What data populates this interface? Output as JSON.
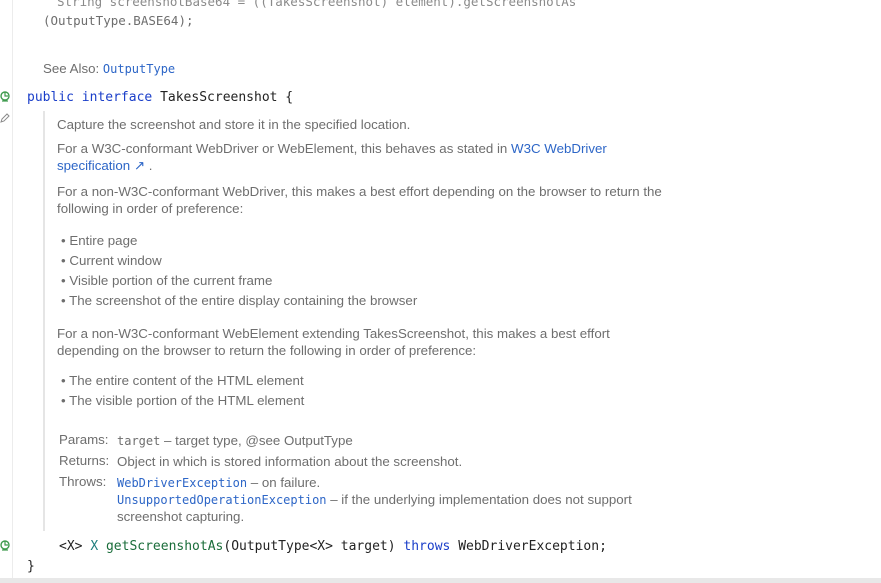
{
  "header_code": {
    "line1": "String screenshotBase64 = ((TakesScreenshot) element).getScreenshotAs",
    "line2": "(OutputType.BASE64);",
    "see_also_label": "See Also:",
    "see_also_link": "OutputType"
  },
  "declaration": {
    "public": "public",
    "interface": "interface",
    "name": "TakesScreenshot {"
  },
  "doc": {
    "p1": "Capture the screenshot and store it in the specified location.",
    "p2_pre": "For a W3C-conformant WebDriver or WebElement, this behaves as stated in ",
    "p2_link": "W3C WebDriver specification",
    "p2_post": " .",
    "p3": "For a non-W3C-conformant WebDriver, this makes a best effort depending on the browser to return the following in order of preference:",
    "list1": [
      "Entire page",
      "Current window",
      "Visible portion of the current frame",
      "The screenshot of the entire display containing the browser"
    ],
    "p4": "For a non-W3C-conformant WebElement extending TakesScreenshot, this makes a best effort depending on the browser to return the following in order of preference:",
    "list2": [
      "The entire content of the HTML element",
      "The visible portion of the HTML element"
    ],
    "params_label": "Params:",
    "params_name": "target",
    "params_desc": " – target type, @see OutputType",
    "returns_label": "Returns:",
    "returns_desc": "Object in which is stored information about the screenshot.",
    "throws_label": "Throws:",
    "throws1_name": "WebDriverException",
    "throws1_desc": " – on failure.",
    "throws2_name": "UnsupportedOperationException",
    "throws2_desc": " – if the underlying implementation does not support",
    "throws2_desc_cont": "screenshot capturing."
  },
  "method": {
    "generic_open": "<X>",
    "generic_x": "X",
    "method_name": "getScreenshotAs",
    "params": "(OutputType<X> target)",
    "throws_kw": "throws",
    "exception": "WebDriverException;"
  },
  "closing_brace": "}",
  "icons": [
    "implemented-icon",
    "edit-icon",
    "implemented-method-icon"
  ]
}
